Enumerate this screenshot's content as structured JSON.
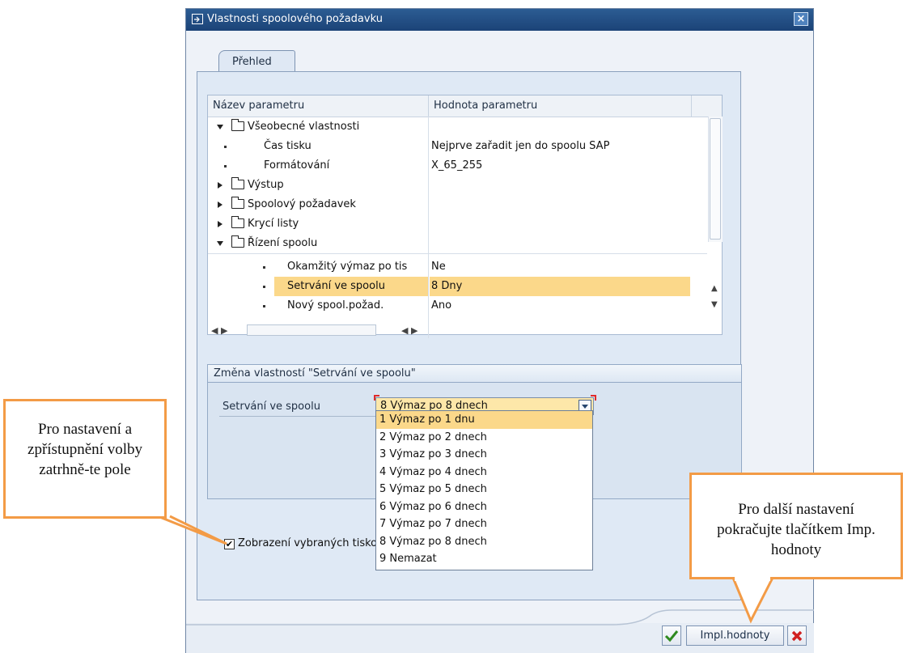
{
  "window": {
    "title": "Vlastnosti spoolového požadavku",
    "close_label": "×"
  },
  "tab": {
    "label": "Přehled"
  },
  "tree": {
    "headers": [
      "Název parametru",
      "Hodnota parametru"
    ],
    "rows": [
      {
        "label": "Všeobecné vlastnosti",
        "value": ""
      },
      {
        "label": "Čas tisku",
        "value": "Nejprve zařadit jen do spoolu SAP"
      },
      {
        "label": "Formátování",
        "value": "X_65_255"
      },
      {
        "label": "Výstup",
        "value": ""
      },
      {
        "label": "Spoolový požadavek",
        "value": ""
      },
      {
        "label": "Krycí listy",
        "value": ""
      },
      {
        "label": "Řízení spoolu",
        "value": ""
      },
      {
        "label": "Okamžitý výmaz po tis",
        "value": "Ne"
      },
      {
        "label": "Setrvání ve spoolu",
        "value": "8  Dny"
      },
      {
        "label": "Nový spool.požad.",
        "value": "Ano"
      }
    ]
  },
  "group": {
    "title": "Změna vlastností \"Setrvání ve spoolu\"",
    "field_label": "Setrvání ve spoolu",
    "selected_value": "8 Výmaz po 8 dnech",
    "options": [
      "1 Výmaz po 1 dnu",
      "2 Výmaz po 2 dnech",
      "3 Výmaz po 3 dnech",
      "4 Výmaz po 4 dnech",
      "5 Výmaz po 5 dnech",
      "6 Výmaz po 6 dnech",
      "7 Výmaz po 7 dnech",
      "8 Výmaz po 8 dnech",
      "9 Nemazat"
    ]
  },
  "checkbox": {
    "label": "Zobrazení vybraných tiskových parametrů",
    "checked": true
  },
  "buttons": {
    "impl_label": "Impl.hodnoty"
  },
  "callouts": {
    "left": "Pro nastavení a zpřístupnění volby zatrhně-te pole",
    "right": "Pro další nastavení pokračujte tlačítkem Imp. hodnoty"
  },
  "colors": {
    "accent": "#f39b46",
    "highlight": "#fbd88a",
    "title_bar": "#2c5c93"
  }
}
